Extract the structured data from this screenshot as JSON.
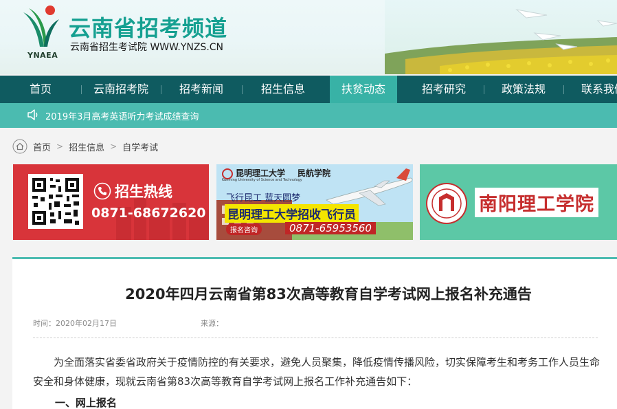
{
  "header": {
    "logo_text": "YNAEA",
    "site_title": "云南省招考频道",
    "site_subtitle": "云南省招生考试院 WWW.YNZS.CN"
  },
  "nav": {
    "items": [
      "首页",
      "云南招考院",
      "招考新闻",
      "招生信息",
      "扶贫动态",
      "招考研究",
      "政策法规",
      "联系我们"
    ],
    "active_item": "扶贫动态"
  },
  "notice": {
    "text": "2019年3月高考英语听力考试成绩查询"
  },
  "breadcrumb": [
    "首页",
    "招生信息",
    "自学考试"
  ],
  "banners": {
    "hotline": {
      "title": "招生热线",
      "phone": "0871-68672620"
    },
    "kust": {
      "school": "昆明理工大学",
      "school_en": "Kunming University of Science and Technology",
      "college": "民航学院",
      "slogan": "飞行昆工 蓝天圆梦",
      "headline": "昆明理工大学招收飞行员",
      "consult_label": "报名咨询",
      "phone": "0871-65953560"
    },
    "nanyang": {
      "name": "南阳理工学院"
    }
  },
  "article": {
    "title": "2020年四月云南省第83次高等教育自学考试网上报名补充通告",
    "time": "时间：2020年02月17日",
    "source": "来源：",
    "paragraph": "为全面落实省委省政府关于疫情防控的有关要求，避免人员聚集，降低疫情传播风险，切实保障考生和考务工作人员生命安全和身体健康，现就云南省第83次高等教育自学考试网上报名工作补充通告如下：",
    "section_1": "一、网上报名"
  },
  "colors": {
    "nav_bg": "#0f5b60",
    "nav_active": "#38b2a6",
    "notice_bg": "#4bbbb0",
    "title_green": "#15a091",
    "hotline_red": "#d8343a"
  }
}
